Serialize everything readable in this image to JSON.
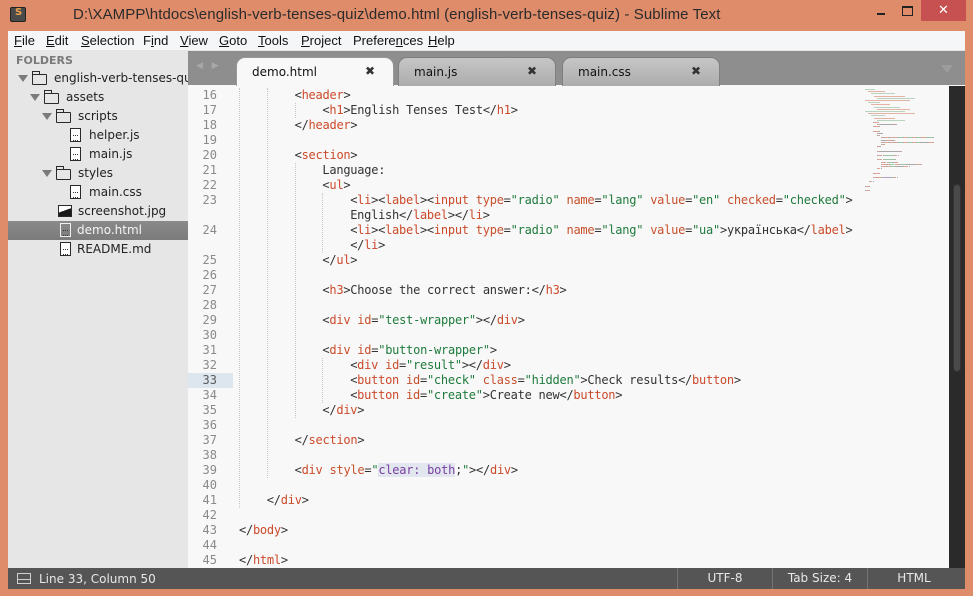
{
  "window": {
    "title": "D:\\XAMPP\\htdocs\\english-verb-tenses-quiz\\demo.html (english-verb-tenses-quiz) - Sublime Text",
    "close_glyph": "✕"
  },
  "menu": [
    {
      "label": "File",
      "mnemonic": "F"
    },
    {
      "label": "Edit",
      "mnemonic": "E"
    },
    {
      "label": "Selection",
      "mnemonic": "S"
    },
    {
      "label": "Find",
      "mnemonic": "i"
    },
    {
      "label": "View",
      "mnemonic": "V"
    },
    {
      "label": "Goto",
      "mnemonic": "G"
    },
    {
      "label": "Tools",
      "mnemonic": "T"
    },
    {
      "label": "Project",
      "mnemonic": "P"
    },
    {
      "label": "Preferences",
      "mnemonic": "n"
    },
    {
      "label": "Help",
      "mnemonic": "H"
    }
  ],
  "sidebar": {
    "header": "FOLDERS",
    "items": [
      {
        "label": "english-verb-tenses-quiz",
        "type": "folder",
        "depth": 0,
        "expanded": true
      },
      {
        "label": "assets",
        "type": "folder",
        "depth": 1,
        "expanded": true
      },
      {
        "label": "scripts",
        "type": "folder",
        "depth": 2,
        "expanded": true
      },
      {
        "label": "helper.js",
        "type": "file",
        "depth": 3
      },
      {
        "label": "main.js",
        "type": "file",
        "depth": 3
      },
      {
        "label": "styles",
        "type": "folder",
        "depth": 2,
        "expanded": true
      },
      {
        "label": "main.css",
        "type": "file",
        "depth": 3
      },
      {
        "label": "screenshot.jpg",
        "type": "image",
        "depth": 2
      },
      {
        "label": "demo.html",
        "type": "file",
        "depth": 1,
        "selected": true
      },
      {
        "label": "README.md",
        "type": "file",
        "depth": 1
      }
    ]
  },
  "tabs": [
    {
      "label": "demo.html",
      "active": true,
      "close": "✖"
    },
    {
      "label": "main.js",
      "active": false,
      "close": "✖"
    },
    {
      "label": "main.css",
      "active": false,
      "close": "✖"
    }
  ],
  "tab_nav": "◀ ▶",
  "editor": {
    "current_line": 33,
    "lines": [
      {
        "n": "16",
        "indent": 2,
        "tokens": [
          [
            "p",
            "<"
          ],
          [
            "t",
            "header"
          ],
          [
            "p",
            ">"
          ]
        ]
      },
      {
        "n": "17",
        "indent": 3,
        "tokens": [
          [
            "p",
            "<"
          ],
          [
            "t",
            "h1"
          ],
          [
            "p",
            ">English Tenses Test</"
          ],
          [
            "t",
            "h1"
          ],
          [
            "p",
            ">"
          ]
        ]
      },
      {
        "n": "18",
        "indent": 2,
        "tokens": [
          [
            "p",
            "</"
          ],
          [
            "t",
            "header"
          ],
          [
            "p",
            ">"
          ]
        ]
      },
      {
        "n": "19",
        "indent": 0,
        "tokens": []
      },
      {
        "n": "20",
        "indent": 2,
        "tokens": [
          [
            "p",
            "<"
          ],
          [
            "t",
            "section"
          ],
          [
            "p",
            ">"
          ]
        ]
      },
      {
        "n": "21",
        "indent": 3,
        "tokens": [
          [
            "p",
            "Language:"
          ]
        ]
      },
      {
        "n": "22",
        "indent": 3,
        "tokens": [
          [
            "p",
            "<"
          ],
          [
            "t",
            "ul"
          ],
          [
            "p",
            ">"
          ]
        ]
      },
      {
        "n": "23",
        "indent": 4,
        "tokens": [
          [
            "p",
            "<"
          ],
          [
            "t",
            "li"
          ],
          [
            "p",
            "><"
          ],
          [
            "t",
            "label"
          ],
          [
            "p",
            "><"
          ],
          [
            "t",
            "input"
          ],
          [
            "p",
            " "
          ],
          [
            "a",
            "type"
          ],
          [
            "p",
            "="
          ],
          [
            "s",
            "\"radio\""
          ],
          [
            "p",
            " "
          ],
          [
            "a",
            "name"
          ],
          [
            "p",
            "="
          ],
          [
            "s",
            "\"lang\""
          ],
          [
            "p",
            " "
          ],
          [
            "a",
            "value"
          ],
          [
            "p",
            "="
          ],
          [
            "s",
            "\"en\""
          ],
          [
            "p",
            " "
          ],
          [
            "a",
            "checked"
          ],
          [
            "p",
            "="
          ],
          [
            "s",
            "\"checked\""
          ],
          [
            "p",
            ">"
          ]
        ]
      },
      {
        "n": "",
        "indent": 4,
        "tokens": [
          [
            "p",
            "English</"
          ],
          [
            "t",
            "label"
          ],
          [
            "p",
            "></"
          ],
          [
            "t",
            "li"
          ],
          [
            "p",
            ">"
          ]
        ]
      },
      {
        "n": "24",
        "indent": 4,
        "tokens": [
          [
            "p",
            "<"
          ],
          [
            "t",
            "li"
          ],
          [
            "p",
            "><"
          ],
          [
            "t",
            "label"
          ],
          [
            "p",
            "><"
          ],
          [
            "t",
            "input"
          ],
          [
            "p",
            " "
          ],
          [
            "a",
            "type"
          ],
          [
            "p",
            "="
          ],
          [
            "s",
            "\"radio\""
          ],
          [
            "p",
            " "
          ],
          [
            "a",
            "name"
          ],
          [
            "p",
            "="
          ],
          [
            "s",
            "\"lang\""
          ],
          [
            "p",
            " "
          ],
          [
            "a",
            "value"
          ],
          [
            "p",
            "="
          ],
          [
            "s",
            "\"ua\""
          ],
          [
            "p",
            ">українська</"
          ],
          [
            "t",
            "label"
          ],
          [
            "p",
            ">"
          ]
        ]
      },
      {
        "n": "",
        "indent": 4,
        "tokens": [
          [
            "p",
            "</"
          ],
          [
            "t",
            "li"
          ],
          [
            "p",
            ">"
          ]
        ]
      },
      {
        "n": "25",
        "indent": 3,
        "tokens": [
          [
            "p",
            "</"
          ],
          [
            "t",
            "ul"
          ],
          [
            "p",
            ">"
          ]
        ]
      },
      {
        "n": "26",
        "indent": 0,
        "tokens": []
      },
      {
        "n": "27",
        "indent": 3,
        "tokens": [
          [
            "p",
            "<"
          ],
          [
            "t",
            "h3"
          ],
          [
            "p",
            ">Choose the correct answer:</"
          ],
          [
            "t",
            "h3"
          ],
          [
            "p",
            ">"
          ]
        ]
      },
      {
        "n": "28",
        "indent": 0,
        "tokens": []
      },
      {
        "n": "29",
        "indent": 3,
        "tokens": [
          [
            "p",
            "<"
          ],
          [
            "t",
            "div"
          ],
          [
            "p",
            " "
          ],
          [
            "a",
            "id"
          ],
          [
            "p",
            "="
          ],
          [
            "s",
            "\"test-wrapper\""
          ],
          [
            "p",
            "></"
          ],
          [
            "t",
            "div"
          ],
          [
            "p",
            ">"
          ]
        ]
      },
      {
        "n": "30",
        "indent": 0,
        "tokens": []
      },
      {
        "n": "31",
        "indent": 3,
        "tokens": [
          [
            "p",
            "<"
          ],
          [
            "t",
            "div"
          ],
          [
            "p",
            " "
          ],
          [
            "a",
            "id"
          ],
          [
            "p",
            "="
          ],
          [
            "s",
            "\"button-wrapper\""
          ],
          [
            "p",
            ">"
          ]
        ]
      },
      {
        "n": "32",
        "indent": 4,
        "tokens": [
          [
            "p",
            "<"
          ],
          [
            "t",
            "div"
          ],
          [
            "p",
            " "
          ],
          [
            "a",
            "id"
          ],
          [
            "p",
            "="
          ],
          [
            "s",
            "\"result\""
          ],
          [
            "p",
            "></"
          ],
          [
            "t",
            "div"
          ],
          [
            "p",
            ">"
          ]
        ]
      },
      {
        "n": "33",
        "indent": 4,
        "tokens": [
          [
            "p",
            "<"
          ],
          [
            "t",
            "button"
          ],
          [
            "p",
            " "
          ],
          [
            "a",
            "id"
          ],
          [
            "p",
            "="
          ],
          [
            "s",
            "\"check\""
          ],
          [
            "p",
            " "
          ],
          [
            "a",
            "class"
          ],
          [
            "p",
            "="
          ],
          [
            "s",
            "\"hidden\""
          ],
          [
            "p",
            ">Check results</"
          ],
          [
            "t",
            "button"
          ],
          [
            "p",
            ">"
          ]
        ]
      },
      {
        "n": "34",
        "indent": 4,
        "tokens": [
          [
            "p",
            "<"
          ],
          [
            "t",
            "button"
          ],
          [
            "p",
            " "
          ],
          [
            "a",
            "id"
          ],
          [
            "p",
            "="
          ],
          [
            "s",
            "\"create\""
          ],
          [
            "p",
            ">Create new</"
          ],
          [
            "t",
            "button"
          ],
          [
            "p",
            ">"
          ]
        ]
      },
      {
        "n": "35",
        "indent": 3,
        "tokens": [
          [
            "p",
            "</"
          ],
          [
            "t",
            "div"
          ],
          [
            "p",
            ">"
          ]
        ]
      },
      {
        "n": "36",
        "indent": 0,
        "tokens": []
      },
      {
        "n": "37",
        "indent": 2,
        "tokens": [
          [
            "p",
            "</"
          ],
          [
            "t",
            "section"
          ],
          [
            "p",
            ">"
          ]
        ]
      },
      {
        "n": "38",
        "indent": 0,
        "tokens": []
      },
      {
        "n": "39",
        "indent": 2,
        "tokens": [
          [
            "p",
            "<"
          ],
          [
            "t",
            "div"
          ],
          [
            "p",
            " "
          ],
          [
            "a",
            "style"
          ],
          [
            "p",
            "="
          ],
          [
            "s",
            "\""
          ],
          [
            "v",
            "clear: both"
          ],
          [
            "p",
            ";"
          ],
          [
            "s",
            "\""
          ],
          [
            "p",
            "></"
          ],
          [
            "t",
            "div"
          ],
          [
            "p",
            ">"
          ]
        ]
      },
      {
        "n": "40",
        "indent": 0,
        "tokens": []
      },
      {
        "n": "41",
        "indent": 1,
        "tokens": [
          [
            "p",
            "</"
          ],
          [
            "t",
            "div"
          ],
          [
            "p",
            ">"
          ]
        ]
      },
      {
        "n": "42",
        "indent": 0,
        "tokens": []
      },
      {
        "n": "43",
        "indent": 0,
        "tokens": [
          [
            "p",
            "</"
          ],
          [
            "t",
            "body"
          ],
          [
            "p",
            ">"
          ]
        ]
      },
      {
        "n": "44",
        "indent": 0,
        "tokens": []
      },
      {
        "n": "45",
        "indent": 0,
        "tokens": [
          [
            "p",
            "</"
          ],
          [
            "t",
            "html"
          ],
          [
            "p",
            ">"
          ]
        ]
      }
    ]
  },
  "statusbar": {
    "position": "Line 33, Column 50",
    "encoding": "UTF-8",
    "tab_size": "Tab Size: 4",
    "syntax": "HTML"
  },
  "colors": {
    "window_frame": "#df8c6b",
    "close_button": "#c75050",
    "tag": "#cc4a2a",
    "attribute": "#c8502c",
    "string": "#1f7b3d",
    "css_value": "#7a3fa0",
    "status_bar": "#555555"
  }
}
